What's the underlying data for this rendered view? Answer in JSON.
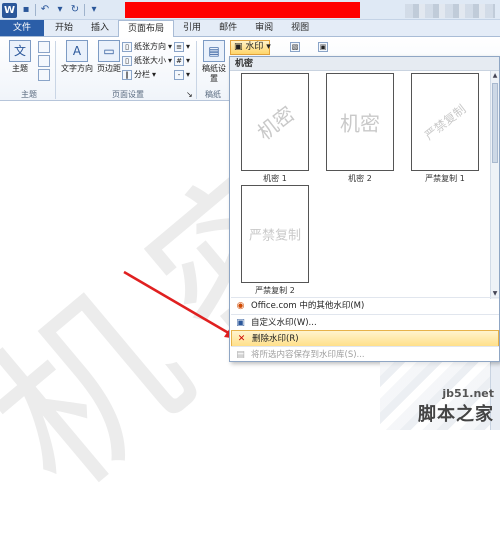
{
  "app": {
    "logo": "W",
    "watermark_text": "机密"
  },
  "tabs": [
    "文件",
    "开始",
    "插入",
    "页面布局",
    "引用",
    "邮件",
    "审阅",
    "视图"
  ],
  "ribbon": {
    "theme_label": "主题",
    "text_dir_label": "文字方向",
    "margins_label": "页边距",
    "orientation_label": "纸张方向",
    "size_label": "纸张大小",
    "columns_label": "分栏",
    "draft_label": "稿纸设置",
    "watermark_label": "水印",
    "group_theme": "主题",
    "group_page_setup": "页面设置",
    "group_draft": "稿纸"
  },
  "dropdown": {
    "header": "机密",
    "thumbnails": [
      {
        "text": "机密",
        "label": "机密 1"
      },
      {
        "text": "机密",
        "label": "机密 2"
      },
      {
        "text": "严禁复制",
        "label": "严禁复制 1"
      },
      {
        "text": "严禁复制",
        "label": "严禁复制 2"
      }
    ],
    "menu": [
      {
        "label": "Office.com 中的其他水印(M)",
        "icon": "office-icon"
      },
      {
        "label": "自定义水印(W)...",
        "icon": "custom-watermark-icon"
      },
      {
        "label": "删除水印(R)",
        "icon": "remove-watermark-icon"
      },
      {
        "label": "将所选内容保存到水印库(S)...",
        "icon": "save-gallery-icon"
      }
    ]
  },
  "site": {
    "url": "jb51.net",
    "name": "脚本之家"
  },
  "colors": {
    "file_tab": "#2b5ea8",
    "redact": "#ff0000",
    "highlight": "#ffe08a",
    "arrow": "#e02020"
  }
}
